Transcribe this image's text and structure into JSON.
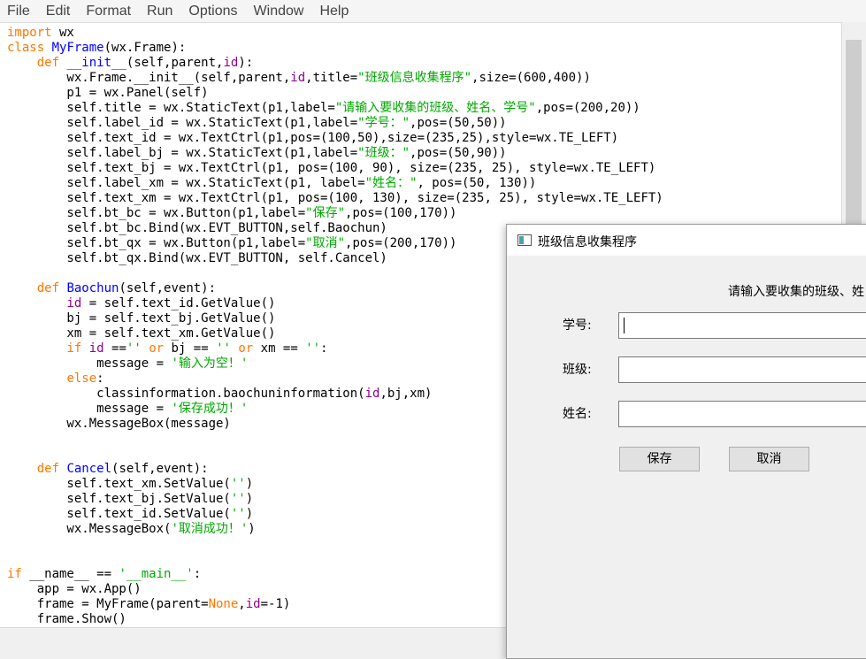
{
  "menu": [
    "File",
    "Edit",
    "Format",
    "Run",
    "Options",
    "Window",
    "Help"
  ],
  "code_lines": [
    [
      {
        "t": "import",
        "c": "kw"
      },
      {
        "t": " wx"
      }
    ],
    [
      {
        "t": "class",
        "c": "kw"
      },
      {
        "t": " "
      },
      {
        "t": "MyFrame",
        "c": "def"
      },
      {
        "t": "(wx.Frame):"
      }
    ],
    [
      {
        "t": "    "
      },
      {
        "t": "def",
        "c": "kw"
      },
      {
        "t": " "
      },
      {
        "t": "__init__",
        "c": "def"
      },
      {
        "t": "(self,parent,"
      },
      {
        "t": "id",
        "c": "bi"
      },
      {
        "t": "):"
      }
    ],
    [
      {
        "t": "        wx.Frame.__init__(self,parent,"
      },
      {
        "t": "id",
        "c": "bi"
      },
      {
        "t": ",title="
      },
      {
        "t": "\"班级信息收集程序\"",
        "c": "str"
      },
      {
        "t": ",size=(600,400))"
      }
    ],
    [
      {
        "t": "        p1 = wx.Panel(self)"
      }
    ],
    [
      {
        "t": "        self.title = wx.StaticText(p1,label="
      },
      {
        "t": "\"请输入要收集的班级、姓名、学号\"",
        "c": "str"
      },
      {
        "t": ",pos=(200,20))"
      }
    ],
    [
      {
        "t": "        self.label_id = wx.StaticText(p1,label="
      },
      {
        "t": "\"学号：\"",
        "c": "str"
      },
      {
        "t": ",pos=(50,50))"
      }
    ],
    [
      {
        "t": "        self.text_id = wx.TextCtrl(p1,pos=(100,50),size=(235,25),style=wx.TE_LEFT)"
      }
    ],
    [
      {
        "t": "        self.label_bj = wx.StaticText(p1,label="
      },
      {
        "t": "\"班级：\"",
        "c": "str"
      },
      {
        "t": ",pos=(50,90))"
      }
    ],
    [
      {
        "t": "        self.text_bj = wx.TextCtrl(p1, pos=(100, 90), size=(235, 25), style=wx.TE_LEFT)"
      }
    ],
    [
      {
        "t": "        self.label_xm = wx.StaticText(p1, label="
      },
      {
        "t": "\"姓名：\"",
        "c": "str"
      },
      {
        "t": ", pos=(50, 130))"
      }
    ],
    [
      {
        "t": "        self.text_xm = wx.TextCtrl(p1, pos=(100, 130), size=(235, 25), style=wx.TE_LEFT)"
      }
    ],
    [
      {
        "t": "        self.bt_bc = wx.Button(p1,label="
      },
      {
        "t": "\"保存\"",
        "c": "str"
      },
      {
        "t": ",pos=(100,170))"
      }
    ],
    [
      {
        "t": "        self.bt_bc.Bind(wx.EVT_BUTTON,self.Baochun)"
      }
    ],
    [
      {
        "t": "        self.bt_qx = wx.Button(p1,label="
      },
      {
        "t": "\"取消\"",
        "c": "str"
      },
      {
        "t": ",pos=(200,170))"
      }
    ],
    [
      {
        "t": "        self.bt_qx.Bind(wx.EVT_BUTTON, self.Cancel)"
      }
    ],
    [
      {
        "t": ""
      }
    ],
    [
      {
        "t": "    "
      },
      {
        "t": "def",
        "c": "kw"
      },
      {
        "t": " "
      },
      {
        "t": "Baochun",
        "c": "def"
      },
      {
        "t": "(self,event):"
      }
    ],
    [
      {
        "t": "        "
      },
      {
        "t": "id",
        "c": "bi"
      },
      {
        "t": " = self.text_id.GetValue()"
      }
    ],
    [
      {
        "t": "        bj = self.text_bj.GetValue()"
      }
    ],
    [
      {
        "t": "        xm = self.text_xm.GetValue()"
      }
    ],
    [
      {
        "t": "        "
      },
      {
        "t": "if",
        "c": "kw"
      },
      {
        "t": " "
      },
      {
        "t": "id",
        "c": "bi"
      },
      {
        "t": " =="
      },
      {
        "t": "''",
        "c": "str"
      },
      {
        "t": " "
      },
      {
        "t": "or",
        "c": "kw"
      },
      {
        "t": " bj == "
      },
      {
        "t": "''",
        "c": "str"
      },
      {
        "t": " "
      },
      {
        "t": "or",
        "c": "kw"
      },
      {
        "t": " xm == "
      },
      {
        "t": "''",
        "c": "str"
      },
      {
        "t": ":"
      }
    ],
    [
      {
        "t": "            message = "
      },
      {
        "t": "'输入为空！'",
        "c": "str"
      }
    ],
    [
      {
        "t": "        "
      },
      {
        "t": "else",
        "c": "kw"
      },
      {
        "t": ":"
      }
    ],
    [
      {
        "t": "            classinformation.baochuninformation("
      },
      {
        "t": "id",
        "c": "bi"
      },
      {
        "t": ",bj,xm)"
      }
    ],
    [
      {
        "t": "            message = "
      },
      {
        "t": "'保存成功！'",
        "c": "str"
      }
    ],
    [
      {
        "t": "        wx.MessageBox(message)"
      }
    ],
    [
      {
        "t": ""
      }
    ],
    [
      {
        "t": ""
      }
    ],
    [
      {
        "t": "    "
      },
      {
        "t": "def",
        "c": "kw"
      },
      {
        "t": " "
      },
      {
        "t": "Cancel",
        "c": "def"
      },
      {
        "t": "(self,event):"
      }
    ],
    [
      {
        "t": "        self.text_xm.SetValue("
      },
      {
        "t": "''",
        "c": "str"
      },
      {
        "t": ")"
      }
    ],
    [
      {
        "t": "        self.text_bj.SetValue("
      },
      {
        "t": "''",
        "c": "str"
      },
      {
        "t": ")"
      }
    ],
    [
      {
        "t": "        self.text_id.SetValue("
      },
      {
        "t": "''",
        "c": "str"
      },
      {
        "t": ")"
      }
    ],
    [
      {
        "t": "        wx.MessageBox("
      },
      {
        "t": "'取消成功！'",
        "c": "str"
      },
      {
        "t": ")"
      }
    ],
    [
      {
        "t": ""
      }
    ],
    [
      {
        "t": ""
      }
    ],
    [
      {
        "t": "if",
        "c": "kw"
      },
      {
        "t": " __name__ == "
      },
      {
        "t": "'__main__'",
        "c": "str"
      },
      {
        "t": ":"
      }
    ],
    [
      {
        "t": "    app = wx.App()"
      }
    ],
    [
      {
        "t": "    frame = MyFrame(parent="
      },
      {
        "t": "None",
        "c": "kw"
      },
      {
        "t": ","
      },
      {
        "t": "id",
        "c": "bi"
      },
      {
        "t": "=-1)"
      }
    ],
    [
      {
        "t": "    frame.Show()"
      }
    ]
  ],
  "dialog": {
    "title": "班级信息收集程序",
    "heading": "请输入要收集的班级、姓",
    "label_id": "学号:",
    "label_bj": "班级:",
    "label_xm": "姓名:",
    "button_save": "保存",
    "button_cancel": "取消"
  }
}
